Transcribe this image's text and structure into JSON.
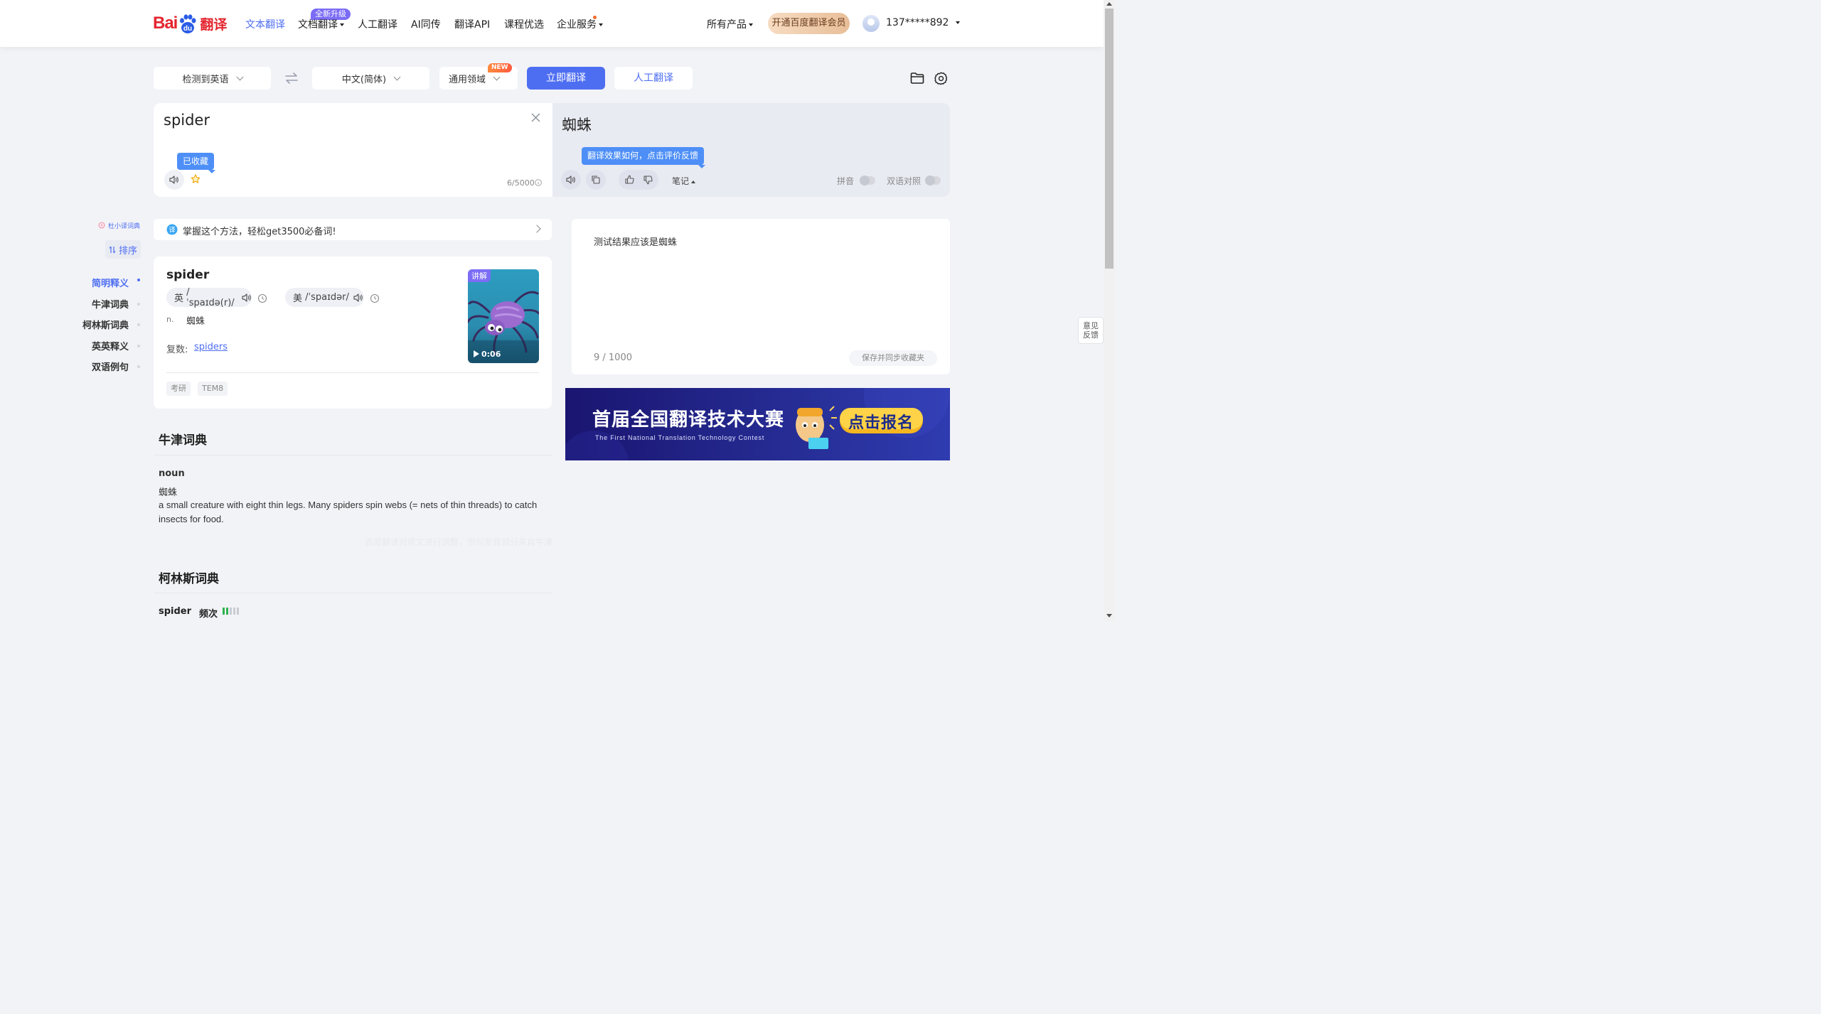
{
  "header": {
    "logo_text_bai": "Bai",
    "logo_text_du": "du",
    "logo_text_fanyi": "翻译",
    "nav": [
      {
        "label": "文本翻译",
        "active": true
      },
      {
        "label": "文档翻译",
        "badge": "全新升级",
        "dropdown": true
      },
      {
        "label": "人工翻译"
      },
      {
        "label": "AI同传"
      },
      {
        "label": "翻译API"
      },
      {
        "label": "课程优选"
      },
      {
        "label": "企业服务",
        "dropdown": true
      }
    ],
    "all_products": "所有产品",
    "vip_button": "开通百度翻译会员",
    "username": "137*****892"
  },
  "toolbar": {
    "source_lang": "检测到英语",
    "target_lang": "中文(简体)",
    "domain": "通用领域",
    "domain_tag": "NEW",
    "translate_button": "立即翻译",
    "human_button": "人工翻译"
  },
  "source": {
    "text": "spider",
    "favorited_tooltip": "已收藏",
    "char_count": "6/5000"
  },
  "target": {
    "text": "蜘蛛",
    "feedback_tooltip": "翻译效果如何，点击评价反馈",
    "notes_label": "笔记",
    "pinyin_label": "拼音",
    "bilingual_label": "双语对照"
  },
  "sidebar": {
    "dict_badge": "杜小译词典",
    "sort_label": "排序",
    "items": [
      "简明释义",
      "牛津词典",
      "柯林斯词典",
      "英英释义",
      "双语例句"
    ]
  },
  "tip_banner": {
    "text": "掌握这个方法，轻松get3500必备词!"
  },
  "dict_card": {
    "word": "spider",
    "uk_label": "英",
    "uk_phonetic": "/ˈspaɪdə(r)/",
    "us_label": "美",
    "us_phonetic": "/ˈspaɪdər/",
    "pos": "n.",
    "meaning": "蜘蛛",
    "plural_label": "复数:",
    "plural_value": "spiders",
    "video_label": "讲解",
    "video_duration": "0:06",
    "tags": [
      "考研",
      "TEM8"
    ]
  },
  "oxford": {
    "title": "牛津词典",
    "pos": "noun",
    "meaning_cn": "蜘蛛",
    "definition": "a small creature with eight thin legs. Many spiders spin webs (= nets of thin threads) to catch insects for food.",
    "disclaimer": "百度翻译对原文进行调整，例句发音部分来自牛津"
  },
  "collins": {
    "title": "柯林斯词典",
    "word": "spider",
    "freq_label": "频次"
  },
  "notes": {
    "content": "测试结果应该是蜘蛛",
    "count": "9 / 1000",
    "save_button": "保存并同步收藏夹"
  },
  "ad": {
    "title": "首届全国翻译技术大赛",
    "subtitle": "The First National Translation Technology Contest",
    "cta": "点击报名"
  },
  "feedback_widget": {
    "line1": "意见",
    "line2": "反馈"
  },
  "colors": {
    "accent": "#4e6ef2",
    "brand_red": "#e4252f",
    "tooltip": "#4e8ff7"
  }
}
